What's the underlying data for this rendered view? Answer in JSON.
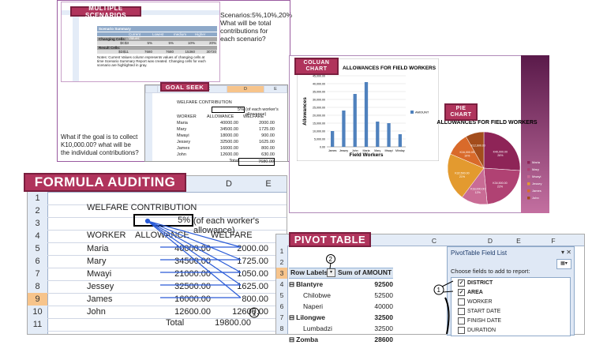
{
  "scenarios": {
    "banner": "MULTIPLE SCENARIOS",
    "question_lines": [
      "Scenarios:5%,10%,20%",
      "What will be total",
      "contributions for",
      "each scenario?"
    ],
    "summary_title": "Scenario Summary",
    "header_row": [
      "Current Values:",
      "Lowest",
      "medium",
      "Higher"
    ],
    "changing_cells_label": "Changing Cells:",
    "changing_row": [
      "$C$3",
      "5%",
      "5%",
      "10%",
      "20%"
    ],
    "result_cells_label": "Result Cells:",
    "result_row": [
      "$D$11",
      "7680",
      "7680",
      "15360",
      "30720"
    ],
    "notes": [
      "Notes: Current Values column represents values of changing cells at",
      "time Scenario Summary Report was created.  Changing cells for each",
      "scenario are highlighted in gray."
    ]
  },
  "goal_seek": {
    "banner": "GOAL SEEK",
    "col_headers": [
      "",
      "B",
      "C",
      "D",
      "E"
    ],
    "title": "WELFARE CONTRIBUTION",
    "rate": "5%",
    "rate_note": "(of each worker's allowance)",
    "headers": [
      "WORKER",
      "ALLOWANCE",
      "WELFARE"
    ],
    "rows": [
      [
        "Maria",
        "40000.00",
        "2000.00"
      ],
      [
        "Mary",
        "34500.00",
        "1725.00"
      ],
      [
        "Mwayi",
        "18000.00",
        "900.00"
      ],
      [
        "Jessey",
        "32500.00",
        "1625.00"
      ],
      [
        "James",
        "16000.00",
        "800.00"
      ],
      [
        "John",
        "12600.00",
        "630.00"
      ]
    ],
    "total_label": "Total",
    "total": "7680.00",
    "question_lines": [
      "What if the goal is to collect",
      "K10,000.00? what will be",
      "the individual contributions?"
    ]
  },
  "column_chart": {
    "banner_lines": [
      "COLUAN",
      "CHART"
    ],
    "chart_data": {
      "type": "bar",
      "title": "ALLOWANCES FOR FIELD WORKERS",
      "xlabel": "Field Workers",
      "ylabel": "Allowances",
      "categories": [
        "James",
        "Jessey",
        "John",
        "Maria",
        "Mary",
        "Mwayi",
        "Minday"
      ],
      "series": [
        {
          "name": "AMOUNT",
          "values": [
            10000,
            23000,
            33500,
            41000,
            16000,
            15000,
            8000
          ]
        }
      ],
      "ylim": [
        0,
        45000
      ],
      "yticks": [
        "0.00",
        "5,000.00",
        "10,000.00",
        "15,000.00",
        "20,000.00",
        "25,000.00",
        "30,000.00",
        "35,000.00",
        "40,000.00",
        "45,000.00"
      ],
      "legend": "right",
      "color": "#4f81bd"
    }
  },
  "pie_chart": {
    "banner_lines": [
      "PIE",
      "CHART"
    ],
    "chart_data": {
      "type": "pie",
      "title": "ALLOWANCES FOR FIELD WORKERS",
      "labels": [
        "Maria",
        "Mary",
        "Mwayi",
        "Jessey",
        "James",
        "John"
      ],
      "values": [
        40000,
        34500,
        18000,
        32500,
        16000,
        12600
      ],
      "data_labels": [
        "K40,000.00, 26%",
        "K34,500.00, 22%",
        "K18,000.00, 12%",
        "K32,500.00, 21%",
        "K16,000.00, 10%",
        "K12,600.00"
      ],
      "legend": "right",
      "colors": [
        "#8e2457",
        "#b04273",
        "#c96c95",
        "#e39a2f",
        "#d96a2a",
        "#a34d1c"
      ]
    }
  },
  "formula_auditing": {
    "banner": "FORMULA AUDITING",
    "col_headers": [
      "C",
      "D",
      "E"
    ],
    "title": "WELFARE CONTRIBUTION",
    "rate": "5%",
    "rate_note": "(of each worker's allowance)",
    "headers": [
      "WORKER",
      "ALLOWANCE",
      "WELFARE"
    ],
    "rows": [
      [
        "Maria",
        "40000.00",
        "2000.00"
      ],
      [
        "Mary",
        "34500.00",
        "1725.00"
      ],
      [
        "Mwayi",
        "21000.00",
        "1050.00"
      ],
      [
        "Jessey",
        "32500.00",
        "1625.00"
      ],
      [
        "James",
        "16000.00",
        "800.00"
      ],
      [
        "John",
        "12600.00",
        "12600.00"
      ]
    ],
    "total_label": "Total",
    "total": "19800.00",
    "callout": "1"
  },
  "pivot_table": {
    "banner": "PIVOT TABLE",
    "col_headers": [
      "C",
      "D",
      "E",
      "F"
    ],
    "row_labels_header": "Row Labels",
    "sum_header": "Sum of AMOUNT",
    "rows": [
      {
        "label": "Blantyre",
        "value": "92500",
        "group": true
      },
      {
        "label": "Chilobwe",
        "value": "52500",
        "group": false
      },
      {
        "label": "Naperi",
        "value": "40000",
        "group": false
      },
      {
        "label": "Lilongwe",
        "value": "32500",
        "group": true
      },
      {
        "label": "Lumbadzi",
        "value": "32500",
        "group": false
      },
      {
        "label": "Zomba",
        "value": "28600",
        "group": true
      }
    ],
    "callout2": "2",
    "callout1": "1",
    "field_list": {
      "title": "PivotTable Field List",
      "choose_label": "Choose fields to add to report:",
      "fields": [
        {
          "name": "DISTRICT",
          "checked": true
        },
        {
          "name": "AREA",
          "checked": true
        },
        {
          "name": "WORKER",
          "checked": false
        },
        {
          "name": "START DATE",
          "checked": false
        },
        {
          "name": "FINISH DATE",
          "checked": false
        },
        {
          "name": "DURATION",
          "checked": false
        }
      ]
    }
  }
}
